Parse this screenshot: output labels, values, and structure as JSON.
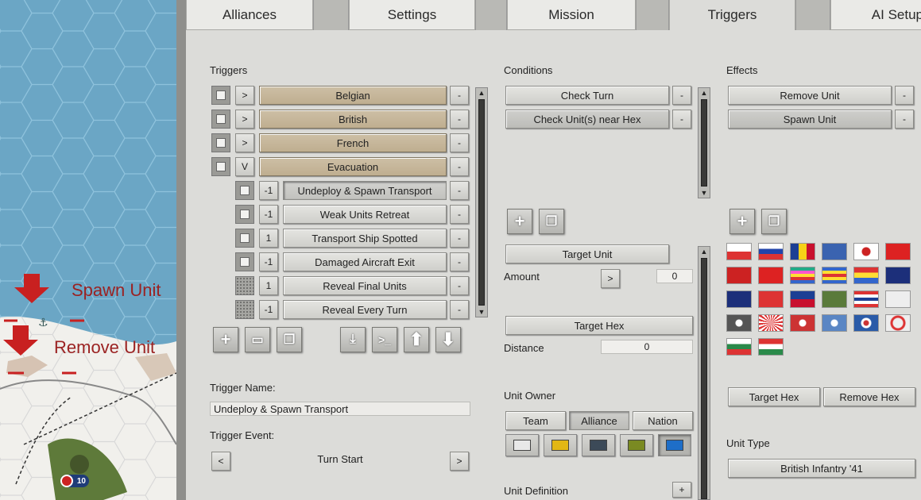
{
  "map": {
    "labels": {
      "spawn": "Spawn Unit",
      "remove": "Remove Unit"
    },
    "unit_badge": "10"
  },
  "tabs": [
    "Alliances",
    "Settings",
    "Mission",
    "Triggers",
    "AI Setup"
  ],
  "active_tab": "Triggers",
  "triggers": {
    "title": "Triggers",
    "groups": [
      {
        "label": "Belgian",
        "toggle": ">"
      },
      {
        "label": "British",
        "toggle": ">"
      },
      {
        "label": "French",
        "toggle": ">"
      },
      {
        "label": "Evacuation",
        "toggle": "V"
      }
    ],
    "items": [
      {
        "num": "-1",
        "label": "Undeploy & Spawn Transport",
        "checked": false
      },
      {
        "num": "-1",
        "label": "Weak Units Retreat",
        "checked": false
      },
      {
        "num": "1",
        "label": "Transport Ship Spotted",
        "checked": false
      },
      {
        "num": "-1",
        "label": "Damaged Aircraft Exit",
        "checked": false
      },
      {
        "num": "1",
        "label": "Reveal Final Units",
        "checked": true
      },
      {
        "num": "-1",
        "label": "Reveal Every Turn",
        "checked": true
      }
    ],
    "remove": "-",
    "name_label": "Trigger Name:",
    "name_value": "Undeploy & Spawn Transport",
    "event_label": "Trigger Event:",
    "event_value": "Turn Start",
    "prev": "<",
    "next": ">"
  },
  "conditions": {
    "title": "Conditions",
    "items": [
      "Check Turn",
      "Check Unit(s) near Hex"
    ],
    "target_unit": "Target Unit",
    "amount_label": "Amount",
    "amount_toggle": ">",
    "amount_value": "0",
    "target_hex": "Target Hex",
    "distance_label": "Distance",
    "distance_value": "0",
    "owner_label": "Unit Owner",
    "owner_options": [
      "Team",
      "Alliance",
      "Nation"
    ],
    "owner_selected": "Alliance",
    "owner_colors": [
      "#e8e8e8",
      "#e2b714",
      "#3c4a58",
      "#7a8a22",
      "#1e6ec8"
    ],
    "definition_label": "Unit Definition",
    "definition_add": "+"
  },
  "effects": {
    "title": "Effects",
    "items": [
      "Remove Unit",
      "Spawn Unit"
    ],
    "target_hex": "Target Hex",
    "remove_hex": "Remove Hex",
    "unit_type_label": "Unit Type",
    "unit_type_value": "British Infantry '41"
  }
}
